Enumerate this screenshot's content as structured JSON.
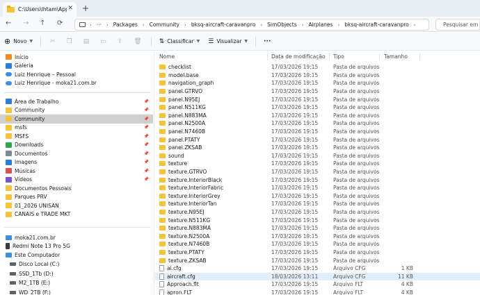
{
  "tab": {
    "title": "C:\\Users\\lhtam\\AppData\\Loca",
    "close": "✕",
    "new": "+"
  },
  "nav": {
    "back": "←",
    "forward": "→",
    "up": "↑",
    "refresh": "⟳",
    "crumbs": [
      "Packages",
      "Community",
      "bksq-aircraft-caravanpro",
      "SimObjects",
      "Airplanes",
      "bksq-aircraft-caravanpro"
    ],
    "ellipsis": "···",
    "search_placeholder": "Pesquisar em bk"
  },
  "toolbar": {
    "new_label": "Novo",
    "sort_label": "Classificar",
    "view_label": "Visualizar",
    "more": "···"
  },
  "sidebar": {
    "items": [
      {
        "label": "Início",
        "icon": "home-icon",
        "kind": "orange",
        "pin": false
      },
      {
        "label": "Galeria",
        "icon": "gallery-icon",
        "kind": "blue",
        "pin": false
      },
      {
        "label": "Luiz Henrique – Pessoal",
        "icon": "onedrive-icon",
        "kind": "cloud",
        "pin": false
      },
      {
        "label": "Luiz Henrique - moka21.com.br",
        "icon": "onedrive-icon",
        "kind": "cloud",
        "pin": false
      },
      {
        "label": "Área de Trabalho",
        "icon": "desktop-icon",
        "kind": "blue",
        "pin": true
      },
      {
        "label": "Community",
        "icon": "folder-icon",
        "kind": "folder",
        "pin": true
      },
      {
        "label": "Community",
        "icon": "folder-icon",
        "kind": "folder",
        "pin": true,
        "selected": true
      },
      {
        "label": "msfs",
        "icon": "folder-icon",
        "kind": "folder",
        "pin": true
      },
      {
        "label": "MSFS",
        "icon": "folder-icon",
        "kind": "folder",
        "pin": true
      },
      {
        "label": "Downloads",
        "icon": "downloads-icon",
        "kind": "green",
        "pin": true
      },
      {
        "label": "Documentos",
        "icon": "documents-icon",
        "kind": "gray",
        "pin": true
      },
      {
        "label": "Imagens",
        "icon": "pictures-icon",
        "kind": "blue",
        "pin": true
      },
      {
        "label": "Músicas",
        "icon": "music-icon",
        "kind": "red",
        "pin": true
      },
      {
        "label": "Vídeos",
        "icon": "videos-icon",
        "kind": "purple",
        "pin": true
      },
      {
        "label": "Documentos Pessoais",
        "icon": "folder-icon",
        "kind": "folder",
        "pin": false
      },
      {
        "label": "Parques PRV",
        "icon": "folder-icon",
        "kind": "folder",
        "pin": false
      },
      {
        "label": "01_2026 UNISAN",
        "icon": "folder-icon",
        "kind": "folder",
        "pin": false
      },
      {
        "label": "CANAIS e TRADE MKT",
        "icon": "folder-icon",
        "kind": "folder",
        "pin": false
      }
    ],
    "devices": [
      {
        "label": "moka21.com.br",
        "icon": "network-drive-icon",
        "kind": "pc"
      },
      {
        "label": "Redmi Note 13 Pro 5G",
        "icon": "phone-icon",
        "kind": "phone"
      },
      {
        "label": "Este Computador",
        "icon": "computer-icon",
        "kind": "pc"
      },
      {
        "label": "Disco Local (C:)",
        "icon": "drive-icon",
        "kind": "drive",
        "indent": true
      },
      {
        "label": "SSD_1Tb (D:)",
        "icon": "drive-icon",
        "kind": "drive",
        "indent": true
      },
      {
        "label": "M2_1TB (E:)",
        "icon": "drive-icon",
        "kind": "drive",
        "indent": true
      },
      {
        "label": "WD_2TB (F:)",
        "icon": "drive-icon",
        "kind": "drive",
        "indent": true
      }
    ]
  },
  "columns": {
    "name": "Nome",
    "date": "Data de modificação",
    "type": "Tipo",
    "size": "Tamanho"
  },
  "files": [
    {
      "name": "checklist",
      "date": "17/03/2026 19:15",
      "type": "Pasta de arquivos",
      "size": "",
      "folder": true
    },
    {
      "name": "model.base",
      "date": "17/03/2026 19:15",
      "type": "Pasta de arquivos",
      "size": "",
      "folder": true
    },
    {
      "name": "navigation_graph",
      "date": "17/03/2026 19:15",
      "type": "Pasta de arquivos",
      "size": "",
      "folder": true
    },
    {
      "name": "panel.GTRVO",
      "date": "17/03/2026 19:15",
      "type": "Pasta de arquivos",
      "size": "",
      "folder": true
    },
    {
      "name": "panel.N95EJ",
      "date": "17/03/2026 19:15",
      "type": "Pasta de arquivos",
      "size": "",
      "folder": true
    },
    {
      "name": "panel.N511KG",
      "date": "17/03/2026 19:15",
      "type": "Pasta de arquivos",
      "size": "",
      "folder": true
    },
    {
      "name": "panel.N883MA",
      "date": "17/03/2026 19:15",
      "type": "Pasta de arquivos",
      "size": "",
      "folder": true
    },
    {
      "name": "panel.N2500A",
      "date": "17/03/2026 19:15",
      "type": "Pasta de arquivos",
      "size": "",
      "folder": true
    },
    {
      "name": "panel.N7460B",
      "date": "17/03/2026 19:15",
      "type": "Pasta de arquivos",
      "size": "",
      "folder": true
    },
    {
      "name": "panel.PTATY",
      "date": "17/03/2026 19:15",
      "type": "Pasta de arquivos",
      "size": "",
      "folder": true
    },
    {
      "name": "panel.ZKSAB",
      "date": "17/03/2026 19:15",
      "type": "Pasta de arquivos",
      "size": "",
      "folder": true
    },
    {
      "name": "sound",
      "date": "17/03/2026 19:15",
      "type": "Pasta de arquivos",
      "size": "",
      "folder": true
    },
    {
      "name": "texture",
      "date": "17/03/2026 19:15",
      "type": "Pasta de arquivos",
      "size": "",
      "folder": true
    },
    {
      "name": "texture.GTRVO",
      "date": "17/03/2026 19:15",
      "type": "Pasta de arquivos",
      "size": "",
      "folder": true
    },
    {
      "name": "texture.InteriorBlack",
      "date": "17/03/2026 19:15",
      "type": "Pasta de arquivos",
      "size": "",
      "folder": true
    },
    {
      "name": "texture.InteriorFabric",
      "date": "17/03/2026 19:15",
      "type": "Pasta de arquivos",
      "size": "",
      "folder": true
    },
    {
      "name": "texture.InteriorGrey",
      "date": "17/03/2026 19:15",
      "type": "Pasta de arquivos",
      "size": "",
      "folder": true
    },
    {
      "name": "texture.InteriorTan",
      "date": "17/03/2026 19:15",
      "type": "Pasta de arquivos",
      "size": "",
      "folder": true
    },
    {
      "name": "texture.N95EJ",
      "date": "17/03/2026 19:15",
      "type": "Pasta de arquivos",
      "size": "",
      "folder": true
    },
    {
      "name": "texture.N511KG",
      "date": "17/03/2026 19:15",
      "type": "Pasta de arquivos",
      "size": "",
      "folder": true
    },
    {
      "name": "texture.N883MA",
      "date": "17/03/2026 19:15",
      "type": "Pasta de arquivos",
      "size": "",
      "folder": true
    },
    {
      "name": "texture.N2500A",
      "date": "17/03/2026 19:15",
      "type": "Pasta de arquivos",
      "size": "",
      "folder": true
    },
    {
      "name": "texture.N7460B",
      "date": "17/03/2026 19:15",
      "type": "Pasta de arquivos",
      "size": "",
      "folder": true
    },
    {
      "name": "texture.PTATY",
      "date": "17/03/2026 19:15",
      "type": "Pasta de arquivos",
      "size": "",
      "folder": true
    },
    {
      "name": "texture.ZKSAB",
      "date": "17/03/2026 19:15",
      "type": "Pasta de arquivos",
      "size": "",
      "folder": true
    },
    {
      "name": "ai.cfg",
      "date": "17/03/2026 19:15",
      "type": "Arquivo CFG",
      "size": "1 KB",
      "folder": false
    },
    {
      "name": "aircraft.cfg",
      "date": "18/03/2026 13:11",
      "type": "Arquivo CFG",
      "size": "11 KB",
      "folder": false,
      "selected": true
    },
    {
      "name": "Approach.flt",
      "date": "17/03/2026 19:15",
      "type": "Arquivo FLT",
      "size": "4 KB",
      "folder": false
    },
    {
      "name": "apron.FLT",
      "date": "17/03/2026 19:15",
      "type": "Arquivo FLT",
      "size": "4 KB",
      "folder": false
    }
  ]
}
